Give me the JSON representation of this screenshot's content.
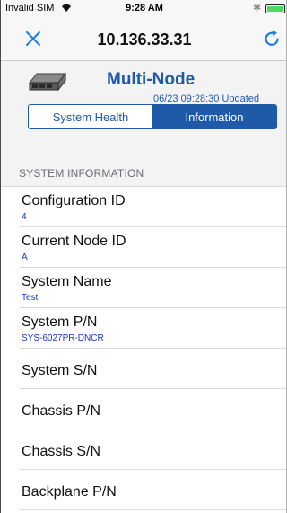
{
  "status_bar": {
    "carrier": "Invalid SIM",
    "time": "9:28 AM",
    "battery_level": 0.95,
    "battery_color": "#4cd964"
  },
  "nav": {
    "title": "10.136.33.31",
    "close_icon": "close-icon",
    "refresh_icon": "refresh-icon"
  },
  "device": {
    "name": "Multi-Node",
    "updated": "06/23 09:28:30 Updated",
    "icon": "server-icon"
  },
  "segments": [
    {
      "label": "System Health",
      "active": false
    },
    {
      "label": "Information",
      "active": true
    }
  ],
  "section": {
    "title": "SYSTEM INFORMATION"
  },
  "rows": [
    {
      "label": "Configuration ID",
      "value": "4"
    },
    {
      "label": "Current Node ID",
      "value": "A"
    },
    {
      "label": "System Name",
      "value": "Test"
    },
    {
      "label": "System P/N",
      "value": "SYS-6027PR-DNCR"
    },
    {
      "label": "System S/N",
      "value": ""
    },
    {
      "label": "Chassis P/N",
      "value": ""
    },
    {
      "label": "Chassis S/N",
      "value": ""
    },
    {
      "label": "Backplane P/N",
      "value": ""
    }
  ],
  "colors": {
    "accent": "#1f5aa8",
    "value_text": "#1a39c8",
    "refresh": "#1e7ee0"
  }
}
